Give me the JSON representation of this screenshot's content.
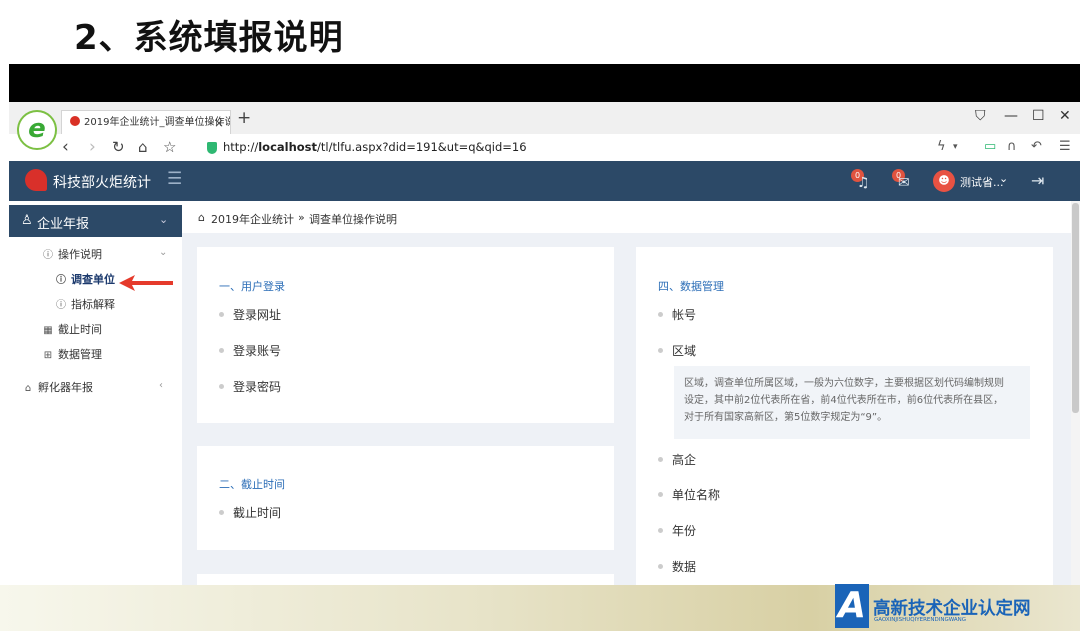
{
  "slide": {
    "title": "2、系统填报说明"
  },
  "browser": {
    "tab_title": "2019年企业统计_调查单位操作说",
    "tab_close": "×",
    "new_tab": "+",
    "url_prefix": "http://",
    "url_host": "localhost",
    "url_path": "/tl/tlfu.aspx?did=191&ut=q&qid=16",
    "logo_letter": "e"
  },
  "app": {
    "name": "科技部火炬统计",
    "notifications": [
      {
        "icon": "bell-icon",
        "badge": "0"
      },
      {
        "icon": "mail-icon",
        "badge": "0"
      }
    ],
    "user": {
      "name": "测试省..."
    }
  },
  "sidebar": {
    "header": "企业年报",
    "items": [
      {
        "label": "操作说明",
        "icon": "help-circle-icon"
      },
      {
        "label": "调查单位",
        "icon": "help-circle-icon",
        "active": true
      },
      {
        "label": "指标解释",
        "icon": "help-circle-icon"
      },
      {
        "label": "截止时间",
        "icon": "calendar-icon"
      },
      {
        "label": "数据管理",
        "icon": "grid-icon"
      }
    ],
    "second_header": "孵化器年报"
  },
  "breadcrumb": {
    "root": "2019年企业统计",
    "sep": "»",
    "current": "调查单位操作说明"
  },
  "left_cards": [
    {
      "section": "一、用户登录",
      "items": [
        "登录网址",
        "登录账号",
        "登录密码"
      ]
    },
    {
      "section": "二、截止时间",
      "items": [
        "截止时间"
      ]
    }
  ],
  "right_card": {
    "section": "四、数据管理",
    "items": [
      "帐号",
      "区域",
      "高企",
      "单位名称",
      "年份",
      "数据"
    ],
    "note_lines": [
      "区域，调查单位所属区域，一般为六位数字，主要根据区划代码编制规则",
      "设定，其中前2位代表所在省，前4位代表所在市，前6位代表所在县区，",
      "对于所有国家高新区，第5位数字规定为“9”。"
    ]
  },
  "watermark": {
    "letter": "A",
    "main": "高新技术企业认定网",
    "sub": "GAOXINJISHUQIYERENDINGWANG"
  }
}
